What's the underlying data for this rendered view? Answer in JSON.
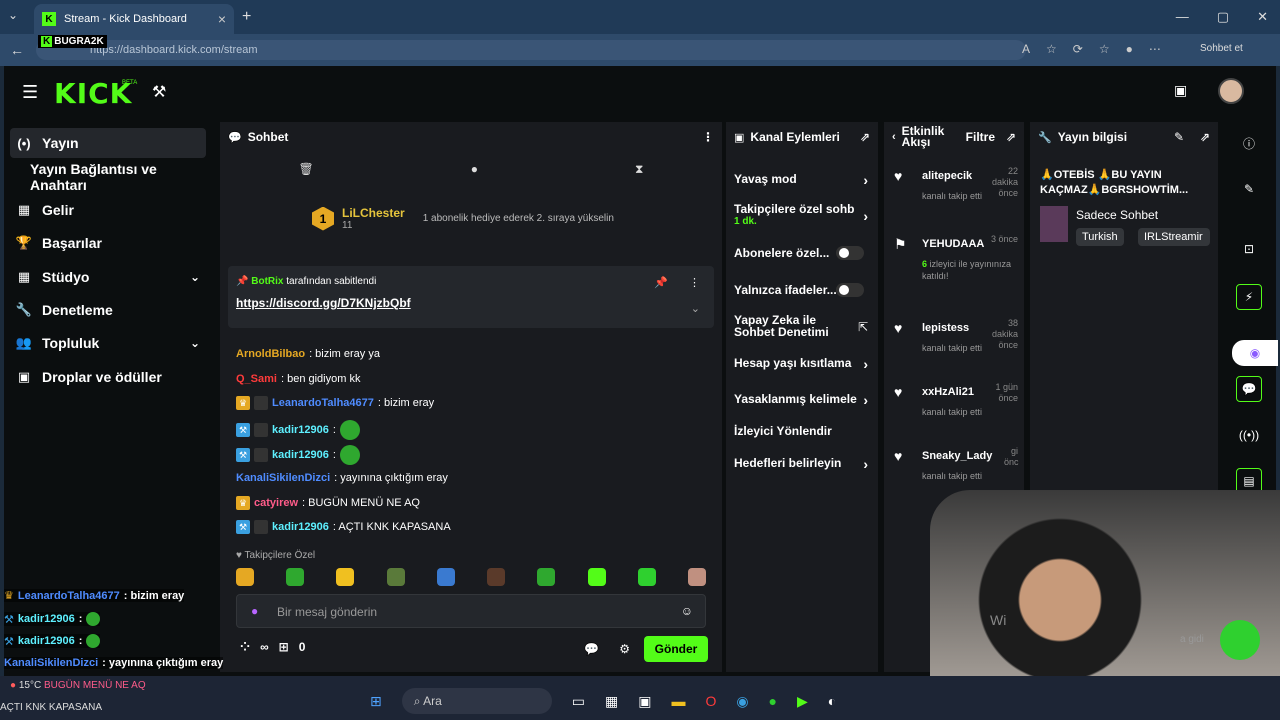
{
  "browser": {
    "tab_title": "Stream - Kick Dashboard",
    "url": "https://dashboard.kick.com/stream",
    "overlay_user": "BUGRA2K",
    "sohbet_et": "Sohbet et"
  },
  "app": {
    "logo": "KICK",
    "beta": "BETA"
  },
  "sidebar": {
    "items": [
      {
        "label": "Yayın",
        "icon": "(•)"
      },
      {
        "label": "Yayın Bağlantısı ve Anahtarı",
        "icon": ""
      },
      {
        "label": "Gelir",
        "icon": "▦"
      },
      {
        "label": "Başarılar",
        "icon": "🏆"
      },
      {
        "label": "Stüdyo",
        "icon": "▦"
      },
      {
        "label": "Denetleme",
        "icon": "🔧"
      },
      {
        "label": "Topluluk",
        "icon": "👥"
      },
      {
        "label": "Droplar ve ödüller",
        "icon": "▣"
      }
    ]
  },
  "chat": {
    "title": "Sohbet",
    "top_gifter_name": "LiLChester",
    "top_gifter_rank": "1",
    "top_gifter_count": "11",
    "gift_msg": "1 abonelik hediye ederek 2. sıraya yükselin",
    "pinned_by": "BotRix",
    "pinned_suffix": "tarafından sabitlendi",
    "pinned_link": "https://discord.gg/D7KNjzbQbf",
    "messages": [
      {
        "user": "ArnoldBilbao",
        "color": "#e5a823",
        "text": ": bizim eray ya"
      },
      {
        "user": "Q_Sami",
        "color": "#ff3b3b",
        "text": ": ben gidiyom kk"
      },
      {
        "user": "LeanardoTalha4677",
        "color": "#4f8cff",
        "text": ": bizim eray"
      },
      {
        "user": "kadir12906",
        "color": "#5ef0ff",
        "text": ":"
      },
      {
        "user": "kadir12906",
        "color": "#5ef0ff",
        "text": ":"
      },
      {
        "user": "KanaliSikilenDizci",
        "color": "#4f8cff",
        "text": ": yayınına çıktığım eray"
      },
      {
        "user": "catyirew",
        "color": "#ff5c8a",
        "text": ": BUGÜN MENÜ NE AQ"
      },
      {
        "user": "kadir12906",
        "color": "#5ef0ff",
        "text": ": AÇTI KNK KAPASANA"
      }
    ],
    "follow_only": "Takipçilere Özel",
    "placeholder": "Bir mesaj gönderin",
    "infinity": "∞",
    "gift_count": "0",
    "send": "Gönder"
  },
  "kanal": {
    "title": "Kanal Eylemleri",
    "items": [
      {
        "label": "Yavaş mod"
      },
      {
        "label": "Takipçilere özel sohb",
        "sub": "1 dk."
      },
      {
        "label": "Abonelere özel..."
      },
      {
        "label": "Yalnızca ifadeler..."
      },
      {
        "label": "Yapay Zeka ile Sohbet Denetimi"
      },
      {
        "label": "Hesap yaşı kısıtlama"
      },
      {
        "label": "Yasaklanmış kelimele"
      },
      {
        "label": "İzleyici Yönlendir"
      },
      {
        "label": "Hedefleri belirleyin"
      }
    ]
  },
  "etkinlik": {
    "title": "Etkinlik Akışı",
    "filter": "Filtre",
    "events": [
      {
        "name": "alitepecik",
        "time": "22 dakika önce",
        "desc": "kanalı takip etti",
        "hl": ""
      },
      {
        "name": "YEHUDAAA",
        "time": "3 önce",
        "desc": "izleyici ile yayınınıza katıldı!",
        "hl": "6"
      },
      {
        "name": "lepistess",
        "time": "38 dakika önce",
        "desc": "kanalı takip etti",
        "hl": ""
      },
      {
        "name": "xxHzAli21",
        "time": "1 gün önce",
        "desc": "kanalı takip etti",
        "hl": ""
      },
      {
        "name": "Sneaky_Lady",
        "time": "gi önc",
        "desc": "kanalı takip etti",
        "hl": ""
      }
    ]
  },
  "yayin": {
    "title": "Yayın bilgisi",
    "stream_title": "🙏OTEBİS 🙏BU YAYIN KAÇMAZ🙏BGRSHOWTİM...",
    "category": "Sadece Sohbet",
    "tags": [
      "Turkish",
      "IRLStreamir"
    ]
  },
  "overlay_chat": [
    {
      "user": "LeanardoTalha4677",
      "color": "#4f8cff",
      "text": ": bizim eray"
    },
    {
      "user": "kadir12906",
      "color": "#5ef0ff",
      "text": ":"
    },
    {
      "user": "kadir12906",
      "color": "#5ef0ff",
      "text": ":"
    },
    {
      "user": "KanaliSikilenDizci",
      "color": "#4f8cff",
      "text": ": yayınına çıktığım eray"
    }
  ],
  "stream_overlay": {
    "wi": "Wi",
    "gidi": "a gidi"
  },
  "taskbar": {
    "weather": "15°C",
    "search": "Ara",
    "bottom_text1": "BUGÜN MENÜ NE AQ",
    "bottom_text2": "AÇTI KNK KAPASANA"
  }
}
